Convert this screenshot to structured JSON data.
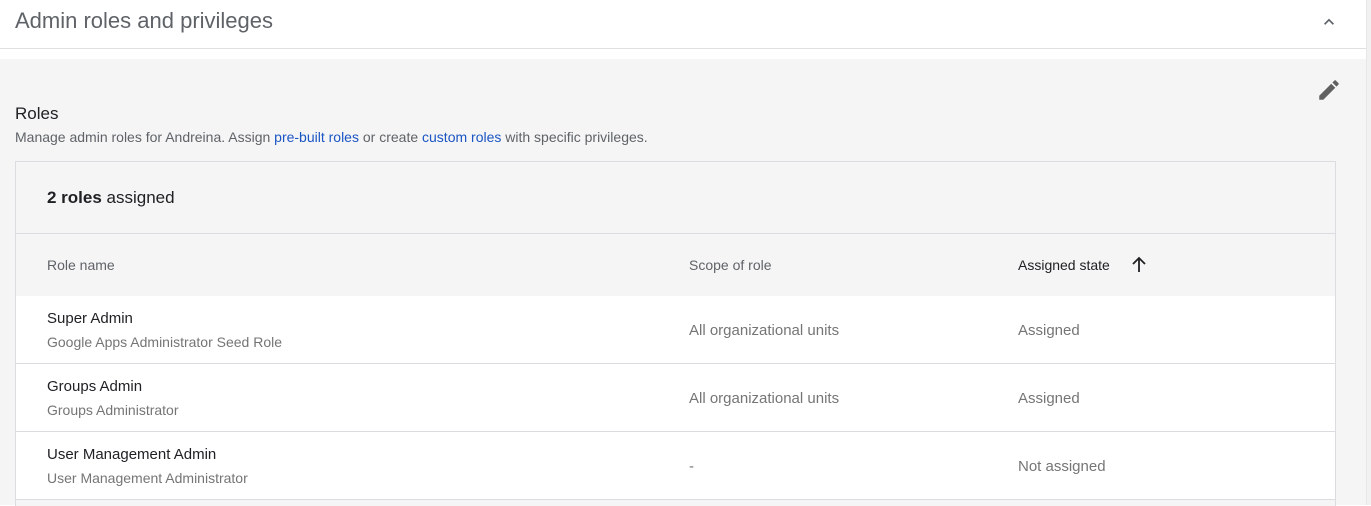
{
  "header": {
    "title": "Admin roles and privileges",
    "collapse_icon": "chevron-up-icon"
  },
  "section": {
    "edit_icon": "pencil-icon",
    "heading": "Roles",
    "desc_prefix": "Manage admin roles for Andreina. Assign ",
    "link_prebuilt": "pre-built roles",
    "desc_middle": " or create ",
    "link_custom": "custom roles",
    "desc_suffix": " with specific privileges."
  },
  "card": {
    "count_bold": "2 roles",
    "count_rest": " assigned"
  },
  "table": {
    "columns": [
      "Role name",
      "Scope of role",
      "Assigned state"
    ],
    "sort_icon": "arrow-up-icon",
    "rows": [
      {
        "name": "Super Admin",
        "desc": "Google Apps Administrator Seed Role",
        "scope": "All organizational units",
        "state": "Assigned"
      },
      {
        "name": "Groups Admin",
        "desc": "Groups Administrator",
        "scope": "All organizational units",
        "state": "Assigned"
      },
      {
        "name": "User Management Admin",
        "desc": "User Management Administrator",
        "scope": "-",
        "state": "Not assigned"
      }
    ]
  },
  "colors": {
    "link": "#1a55c4",
    "section_bg": "#f5f5f5",
    "muted_text": "#757575"
  }
}
